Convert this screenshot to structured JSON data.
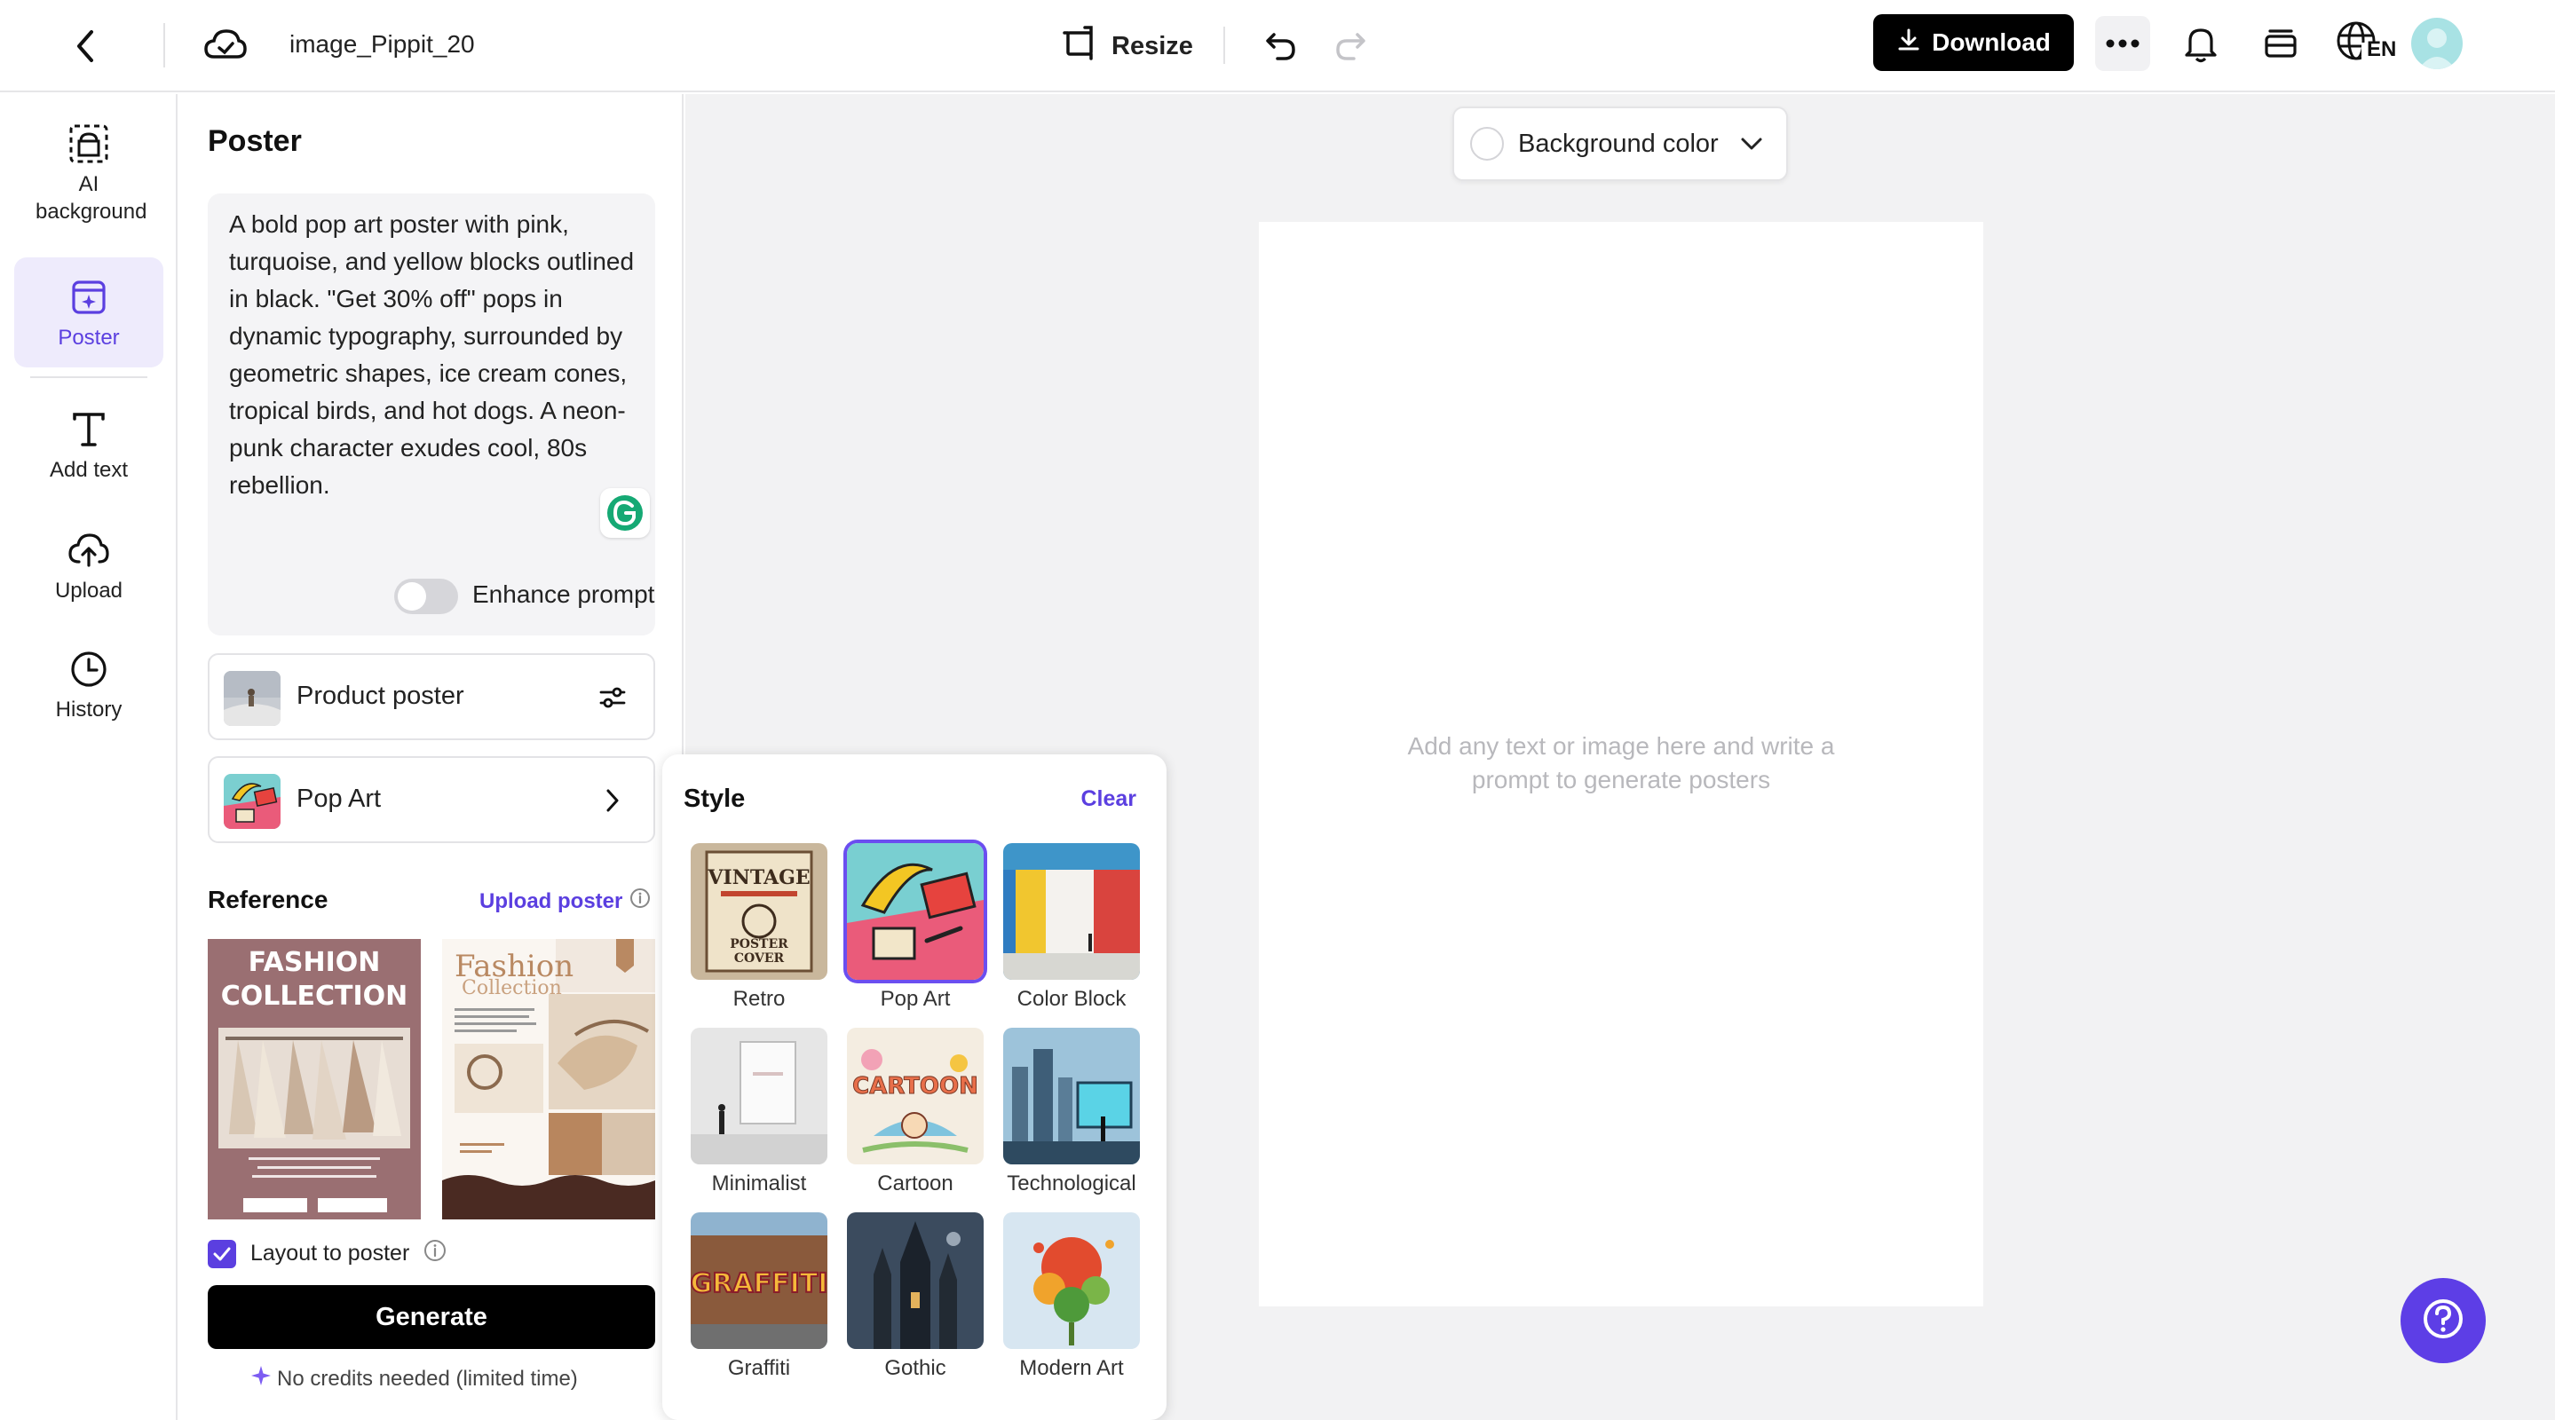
{
  "topbar": {
    "file_name": "image_Pippit_20",
    "resize_label": "Resize",
    "download_label": "Download",
    "language_code": "EN"
  },
  "rail": {
    "items": [
      {
        "label": "AI background",
        "icon": "ai-background-icon"
      },
      {
        "label": "Poster",
        "icon": "poster-icon",
        "active": true
      },
      {
        "label": "Add text",
        "icon": "text-icon"
      },
      {
        "label": "Upload",
        "icon": "upload-icon"
      },
      {
        "label": "History",
        "icon": "history-icon"
      }
    ]
  },
  "panel": {
    "title": "Poster",
    "prompt": "A bold pop art poster with pink, turquoise, and yellow blocks outlined in black. \"Get 30% off\" pops in dynamic typography, surrounded by geometric shapes, ice cream cones, tropical birds, and hot dogs. A neon-punk character exudes cool, 80s rebellion.",
    "enhance_label": "Enhance prompt",
    "enhance_on": false,
    "type_label": "Product poster",
    "style_label": "Pop Art",
    "reference_title": "Reference",
    "upload_poster_label": "Upload poster",
    "reference_images": [
      "fashion-collection-rack",
      "fashion-collection-shoes"
    ],
    "layout_label": "Layout to poster",
    "layout_checked": true,
    "generate_label": "Generate",
    "credits_text": "No credits needed (limited time)"
  },
  "style_popup": {
    "title": "Style",
    "clear_label": "Clear",
    "selected": "Pop Art",
    "styles": [
      "Retro",
      "Pop Art",
      "Color Block",
      "Minimalist",
      "Cartoon",
      "Technological",
      "Graffiti",
      "Gothic",
      "Modern Art"
    ]
  },
  "canvas": {
    "bg_color_label": "Background color",
    "hint": "Add any text or image here and write a prompt to generate posters"
  },
  "colors": {
    "accent": "#5b3fe0",
    "primary_button": "#000000",
    "canvas_bg": "#f2f2f3"
  }
}
